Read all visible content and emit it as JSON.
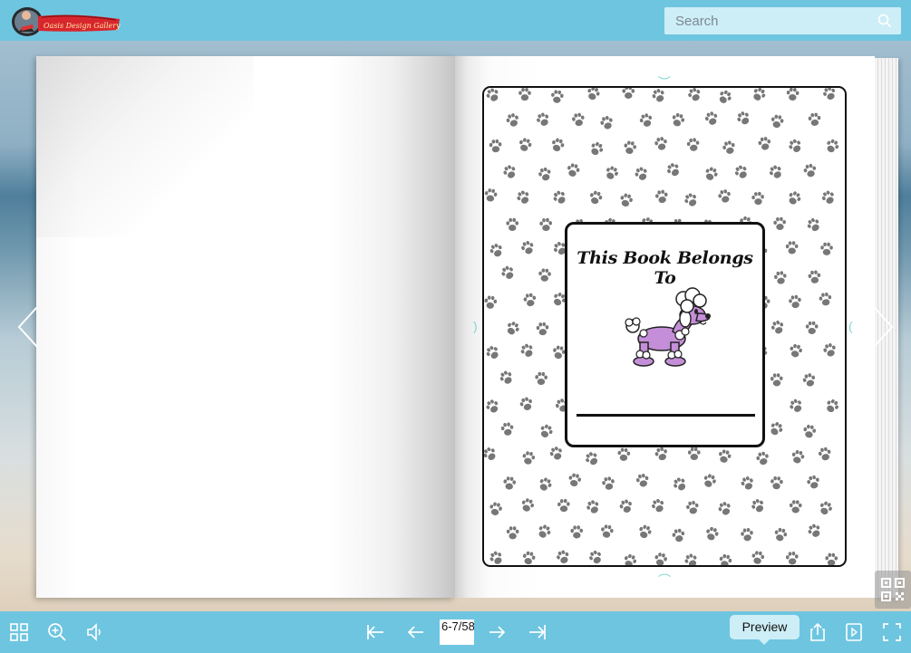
{
  "header": {
    "logo_text": "Oasis Design Gallery Inc",
    "search": {
      "placeholder": "Search",
      "value": ""
    }
  },
  "book": {
    "right_page": {
      "label_title": "This Book Belongs To",
      "illustration": "purple-poodle",
      "pattern": "paw-prints"
    }
  },
  "toolbar": {
    "page_indicator": "6-7/58",
    "tooltip": "Preview",
    "icons": {
      "thumbnails": "grid-icon",
      "zoom": "zoom-in-icon",
      "sound": "speaker-icon",
      "first": "first-page-icon",
      "prev": "arrow-left-icon",
      "next": "arrow-right-icon",
      "last": "last-page-icon",
      "share": "share-icon",
      "preview": "preview-icon",
      "fullscreen": "fullscreen-icon",
      "qr": "qr-code-icon"
    }
  },
  "colors": {
    "bar": "#6ec5e0",
    "search_bg": "#cdeef7",
    "paw": "#777777",
    "poodle": "#c48fd8"
  }
}
